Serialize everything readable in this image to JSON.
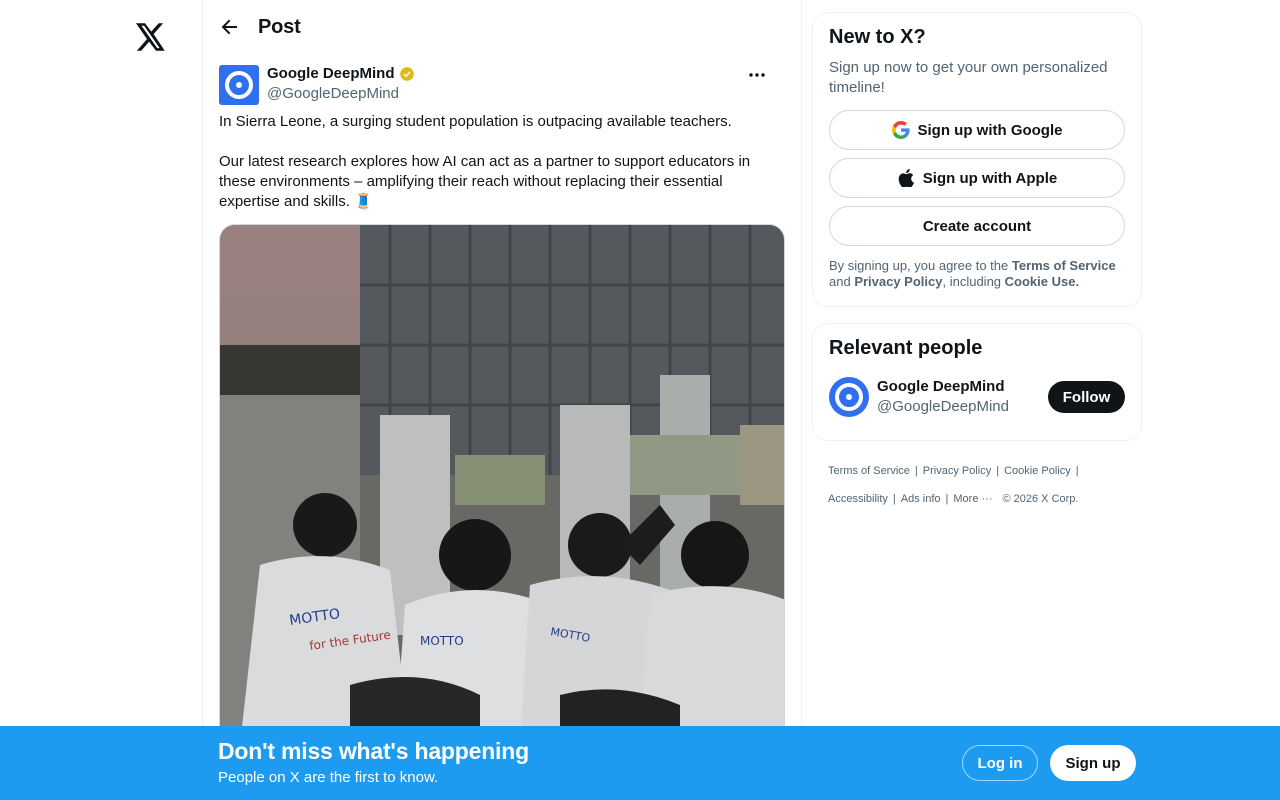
{
  "header": {
    "title": "Post"
  },
  "post": {
    "author_name": "Google DeepMind",
    "author_handle": "@GoogleDeepMind",
    "text_p1": "In Sierra Leone, a surging student population is outpacing available teachers.",
    "text_p2": "Our latest research explores how AI can act as a partner to support educators in these environments –  amplifying their reach without replacing their essential expertise and skills. 🧵",
    "icons": {
      "more": "more-icon",
      "verified": "verified-badge-icon",
      "back": "back-arrow-icon"
    }
  },
  "signup_card": {
    "title": "New to X?",
    "subtitle": "Sign up now to get your own personalized timeline!",
    "google_label": "Sign up with Google",
    "apple_label": "Sign up with Apple",
    "create_label": "Create account",
    "legal_prefix": "By signing up, you agree to the ",
    "terms": "Terms of Service",
    "and": " and ",
    "privacy": "Privacy Policy",
    "including": ", including ",
    "cookie": "Cookie Use."
  },
  "relevant": {
    "title": "Relevant people",
    "person_name": "Google DeepMind",
    "person_handle": "@GoogleDeepMind",
    "follow_label": "Follow"
  },
  "footer": {
    "terms": "Terms of Service",
    "privacy": "Privacy Policy",
    "cookie": "Cookie Policy",
    "accessibility": "Accessibility",
    "ads": "Ads info",
    "more": "More ···",
    "copyright": "© 2026 X Corp."
  },
  "banner": {
    "title": "Don't miss what's happening",
    "subtitle": "People on X are the first to know.",
    "login": "Log in",
    "signup": "Sign up"
  },
  "colors": {
    "brand_blue": "#1d9bf0",
    "deepmind_blue": "#2f6ff0",
    "text": "#0f1419",
    "muted": "#536471"
  }
}
